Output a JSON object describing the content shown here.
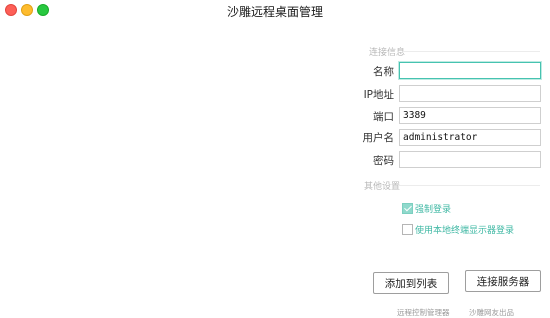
{
  "window": {
    "title": "沙雕远程桌面管理"
  },
  "form": {
    "section_basic": "连接信息",
    "section_other": "其他设置",
    "name": {
      "label": "名称",
      "value": ""
    },
    "ip": {
      "label": "IP地址",
      "value": ""
    },
    "port": {
      "label": "端口",
      "value": "3389"
    },
    "username": {
      "label": "用户名",
      "value": "administrator"
    },
    "password": {
      "label": "密码",
      "value": ""
    }
  },
  "options": {
    "force_login": {
      "label": "强制登录",
      "checked": true
    },
    "local_display": {
      "label": "使用本地终端显示器登录",
      "checked": false
    }
  },
  "buttons": {
    "add_to_list": "添加到列表",
    "connect": "连接服务器"
  },
  "footer": {
    "link1": "远程控制管理器",
    "link2": "沙雕网友出品"
  },
  "colors": {
    "accent": "#46c3b0",
    "check_fill": "#8fd9cc"
  }
}
